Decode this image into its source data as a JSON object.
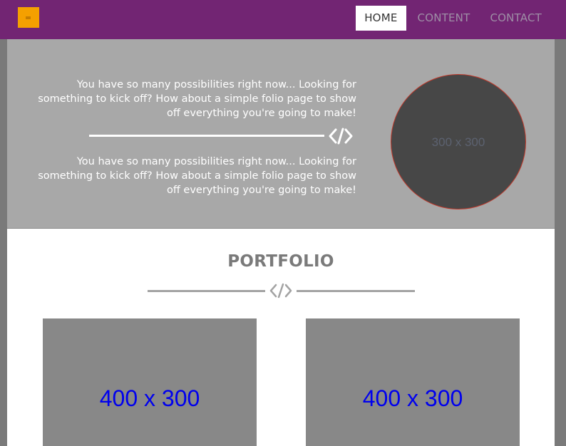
{
  "navbar": {
    "background": "#722573",
    "logo_color": "#f5a000",
    "items": [
      {
        "label": "HOME",
        "active": true
      },
      {
        "label": "CONTENT",
        "active": false
      },
      {
        "label": "CONTACT",
        "active": false
      }
    ]
  },
  "hero": {
    "text_1": "You have so many possibilities right now... Looking for something to kick off? How about a simple folio page to show off everything you're going to make!",
    "text_2": "You have so many possibilities right now... Looking for something to kick off? How about a simple folio page to show off everything you're going to make!",
    "divider_icon": "code-icon",
    "avatar_placeholder": "300 x 300"
  },
  "portfolio": {
    "title": "PORTFOLIO",
    "divider_icon": "code-icon",
    "items": [
      {
        "placeholder": "400 x 300"
      },
      {
        "placeholder": "400 x 300"
      }
    ]
  }
}
